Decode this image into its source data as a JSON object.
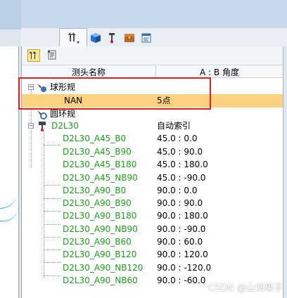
{
  "tree": {
    "header_col_name": "测头名称",
    "header_col_angle": "A : B 角度",
    "groups": [
      {
        "label": "球形规",
        "children": [
          {
            "name": "NAN",
            "value": "5点"
          }
        ]
      },
      {
        "label": "圆环规",
        "children": []
      },
      {
        "label": "D2L30",
        "value": "自动索引",
        "children": [
          {
            "name": "D2L30_A45_B0",
            "value": "45.0 : 0.0"
          },
          {
            "name": "D2L30_A45_B90",
            "value": "45.0 : 90.0"
          },
          {
            "name": "D2L30_A45_B180",
            "value": "45.0 : 180.0"
          },
          {
            "name": "D2L30_A45_NB90",
            "value": "45.0 : -90.0"
          },
          {
            "name": "D2L30_A90_B0",
            "value": "90.0 : 0.0"
          },
          {
            "name": "D2L30_A90_B90",
            "value": "90.0 : 90.0"
          },
          {
            "name": "D2L30_A90_B180",
            "value": "90.0 : 180.0"
          },
          {
            "name": "D2L30_A90_NB90",
            "value": "90.0 : -90.0"
          },
          {
            "name": "D2L30_A90_B60",
            "value": "90.0 : 60.0"
          },
          {
            "name": "D2L30_A90_B120",
            "value": "90.0 : 120.0"
          },
          {
            "name": "D2L30_A90_NB120",
            "value": "90.0 : -120.0"
          },
          {
            "name": "D2L30_A90_NB60",
            "value": "90.0 : -60.0"
          }
        ]
      }
    ]
  },
  "watermark": "CSDN @山涧果子",
  "colors": {
    "highlight": "#fbd27f",
    "annotation": "#e02020",
    "probe_text": "#1aa31a"
  },
  "icons": [
    "probe-tab-icon",
    "cube-icon",
    "probe-icon",
    "chest-icon",
    "report-icon",
    "probe-filter-icon",
    "note-icon"
  ]
}
